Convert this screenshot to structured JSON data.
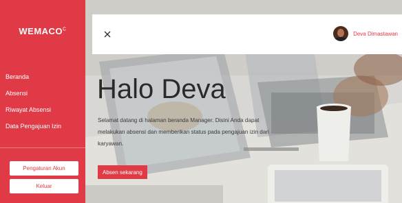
{
  "sidebar": {
    "brand": "WEMACO",
    "brand_mark": "C",
    "nav": [
      {
        "label": "Beranda"
      },
      {
        "label": "Absensi"
      },
      {
        "label": "Riwayat Absensi"
      },
      {
        "label": "Data Pengajuan Izin"
      }
    ],
    "settings_button": "Pengaturan Akun",
    "logout_button": "Keluar"
  },
  "topbar": {
    "close_icon": "close-icon",
    "user_name": "Deva Dimastawan"
  },
  "hero": {
    "title": "Halo Deva",
    "description": "Selamat datang di halaman beranda Manager. Disini Anda dapat melakukan absensi dan memberikan status pada pengajuan izin dari karyawan.",
    "button": "Absen sekarang"
  },
  "colors": {
    "accent": "#e03a46",
    "background_photo": "#d8d6d2"
  }
}
